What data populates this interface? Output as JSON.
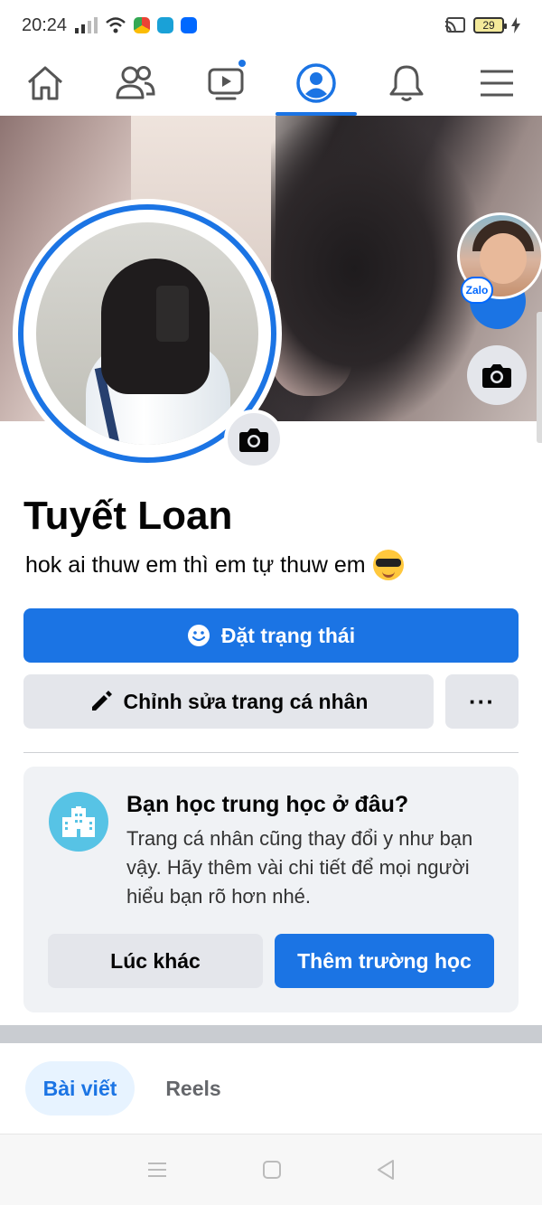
{
  "status_bar": {
    "time": "20:24",
    "battery": "29"
  },
  "top_nav": {
    "items": [
      {
        "name": "home",
        "icon": "home-icon"
      },
      {
        "name": "friends",
        "icon": "friends-icon"
      },
      {
        "name": "watch",
        "icon": "video-icon",
        "badge": true
      },
      {
        "name": "profile",
        "icon": "profile-icon",
        "active": true
      },
      {
        "name": "notifications",
        "icon": "bell-icon"
      },
      {
        "name": "menu",
        "icon": "menu-icon"
      }
    ]
  },
  "profile": {
    "name": "Tuyết Loan",
    "bio": "hok ai thuw  em thì em tự thuw  em"
  },
  "floating": {
    "zalo_label": "Zalo"
  },
  "actions": {
    "set_status_label": "Đặt trạng thái",
    "edit_profile_label": "Chỉnh sửa trang cá nhân",
    "more_label": "···"
  },
  "suggestion_card": {
    "title": "Bạn học trung học ở đâu?",
    "body": "Trang cá nhân cũng thay đổi y như bạn vậy. Hãy thêm vài chi tiết để mọi người hiểu bạn rõ hơn nhé.",
    "later_label": "Lúc khác",
    "add_school_label": "Thêm trường học"
  },
  "tabs": {
    "posts_label": "Bài viết",
    "reels_label": "Reels"
  },
  "colors": {
    "accent": "#1b74e4",
    "secondary_button": "#e4e6eb",
    "card_bg": "#f0f2f5"
  }
}
